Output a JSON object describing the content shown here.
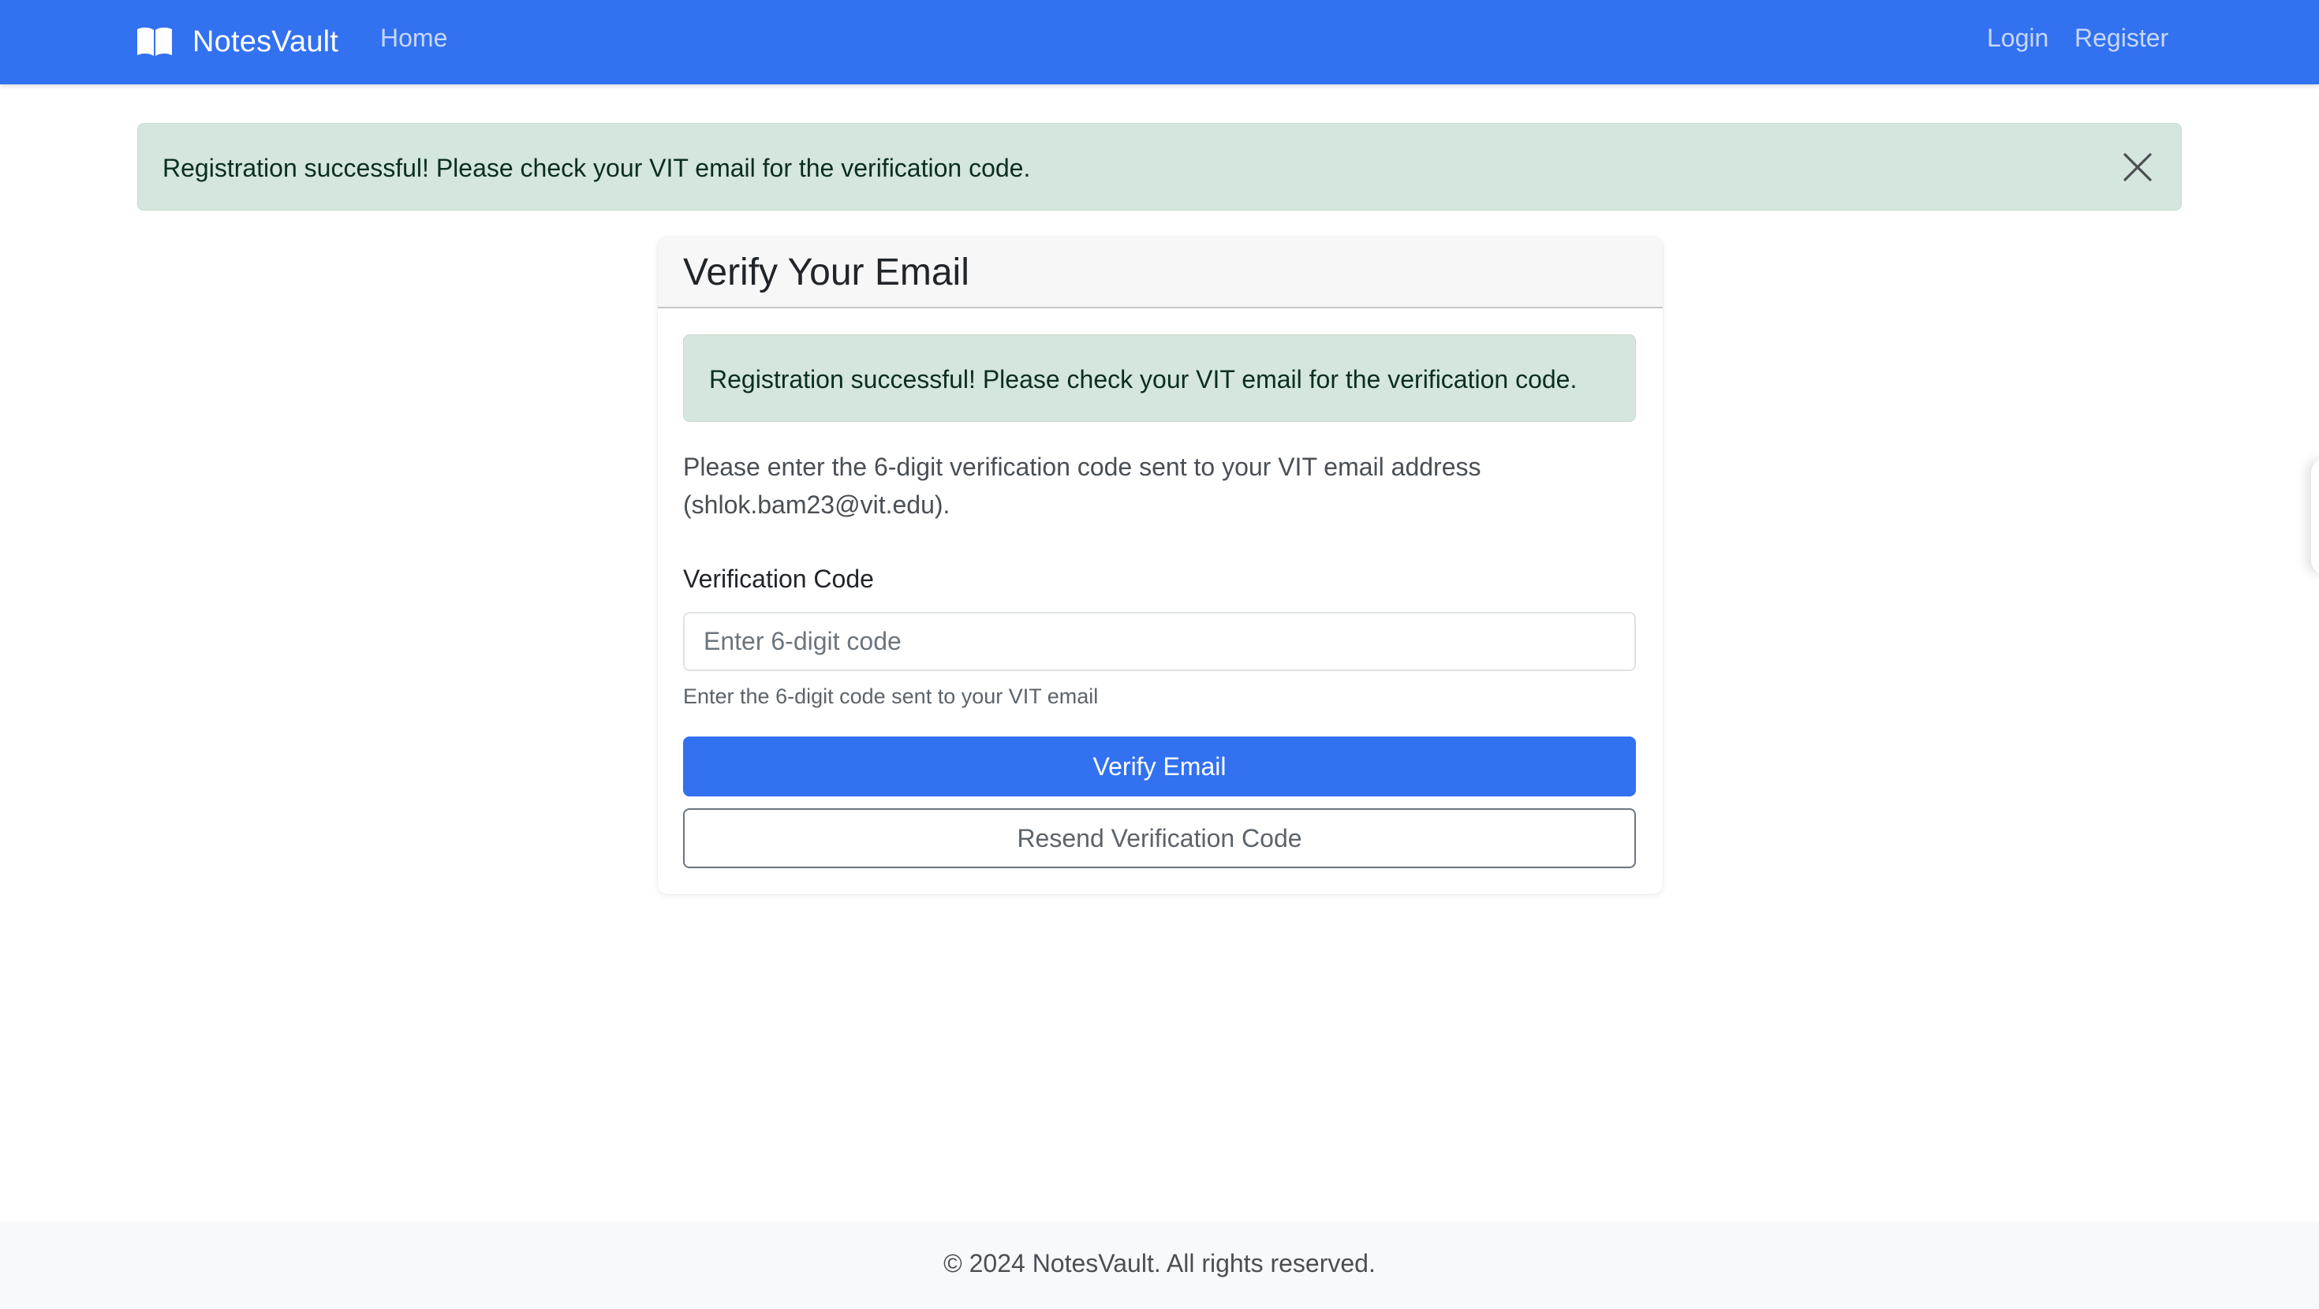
{
  "navbar": {
    "brand": "NotesVault",
    "brand_icon": "book-open-icon",
    "links": {
      "home": "Home",
      "login": "Login",
      "register": "Register"
    },
    "background": "#3271f0"
  },
  "flash_alert": {
    "message": "Registration successful! Please check your VIT email for the verification code.",
    "close_icon": "close-icon",
    "background": "#d4e6dd"
  },
  "card": {
    "title": "Verify Your Email",
    "alert_message": "Registration successful! Please check your VIT email for the verification code.",
    "instructions": "Please enter the 6-digit verification code sent to your VIT email address (shlok.bam23@vit.edu).",
    "code_field": {
      "label": "Verification Code",
      "value": "",
      "placeholder": "Enter 6-digit code",
      "help_text": "Enter the 6-digit code sent to your VIT email"
    },
    "verify_button": "Verify Email",
    "resend_button": "Resend Verification Code"
  },
  "footer": {
    "text": "© 2024 NotesVault. All rights reserved."
  }
}
